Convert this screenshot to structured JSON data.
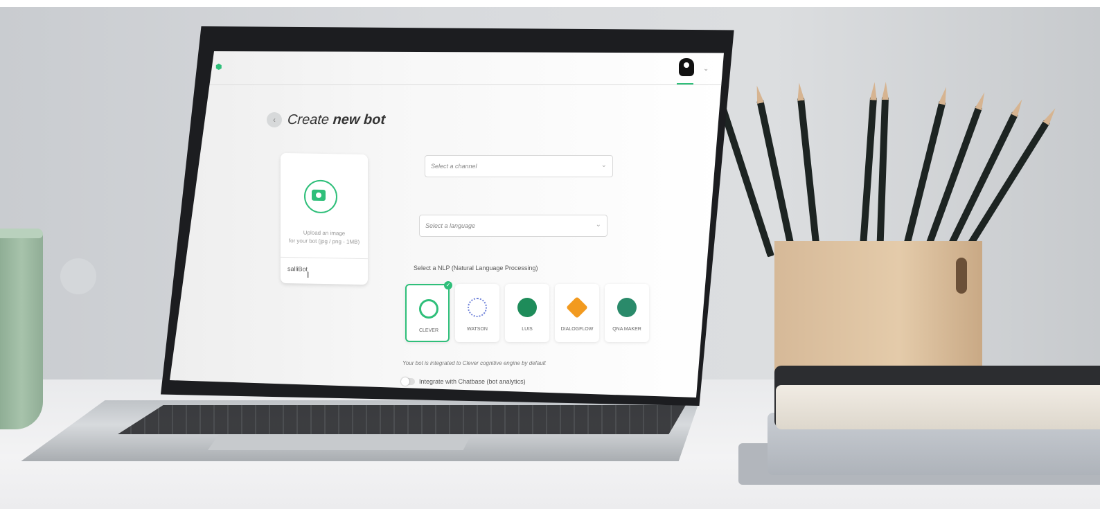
{
  "app": {
    "title_prefix": "Create ",
    "title_bold": "new bot"
  },
  "upload": {
    "line1": "Upload an image",
    "line2": "for your bot (jpg / png - 1MB)",
    "bot_name": "salliBot"
  },
  "channel": {
    "placeholder": "Select a channel"
  },
  "language": {
    "placeholder": "Select a language"
  },
  "nlp": {
    "label": "Select a NLP (Natural Language Processing)",
    "providers": [
      {
        "name": "CLEVER",
        "selected": true,
        "icon": "clever-icon"
      },
      {
        "name": "WATSON",
        "selected": false,
        "icon": "watson-icon"
      },
      {
        "name": "LUIS",
        "selected": false,
        "icon": "luis-icon"
      },
      {
        "name": "DIALOGFLOW",
        "selected": false,
        "icon": "dialogflow-icon"
      },
      {
        "name": "QNA MAKER",
        "selected": false,
        "icon": "qna-maker-icon"
      }
    ]
  },
  "info_text": "Your bot is integrated to Clever cognitive engine by default",
  "chatbase": {
    "label": "Integrate with Chatbase (bot analytics)",
    "enabled": false
  },
  "colors": {
    "accent": "#2fbf7a"
  }
}
